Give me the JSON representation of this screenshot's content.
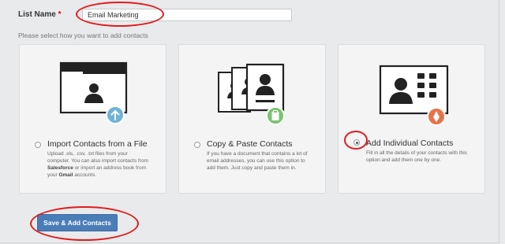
{
  "form": {
    "list_name_label": "List Name",
    "required_mark": "*",
    "list_name_value": "Email Marketing",
    "hint": "Please select how you want to add contacts"
  },
  "options": [
    {
      "title": "Import Contacts from a File",
      "desc_1": "Upload .xls, .csv, .txt files from your computer. You can also import contacts from ",
      "desc_bold_1": "Salesforce",
      "desc_2": " or import an address book from your ",
      "desc_bold_2": "Gmail",
      "desc_3": " accounts.",
      "selected": false,
      "badge_icon": "upload-arrow-icon",
      "badge_color": "#6fb3d6"
    },
    {
      "title": "Copy & Paste Contacts",
      "desc": "If you have a document that contains a lot of email addresses, you can use this option to add them. Just copy and paste them in.",
      "selected": false,
      "badge_icon": "clipboard-icon",
      "badge_color": "#7ac470"
    },
    {
      "title": "Add Individual Contacts",
      "desc": "Fill in all the details of your contacts with this option and add them one by one.",
      "selected": true,
      "badge_icon": "pen-nib-icon",
      "badge_color": "#e8734a"
    }
  ],
  "actions": {
    "save_label": "Save & Add Contacts"
  },
  "colors": {
    "accent_button": "#4a7db8",
    "annotation_red": "#e01b1b"
  }
}
